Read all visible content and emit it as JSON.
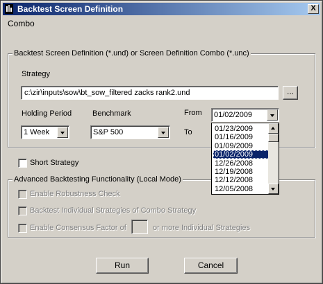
{
  "window": {
    "title": "Backtest Screen Definition",
    "close_label": "X"
  },
  "mode_label": "Combo",
  "definition_group": {
    "legend": "Backtest Screen Definition (*.und) or Screen Definition Combo (*.unc)",
    "strategy_label": "Strategy",
    "strategy_value": "c:\\zir\\inputs\\sow\\bt_sow_filtered zacks rank2.und",
    "browse_label": "...",
    "holding_period_label": "Holding Period",
    "holding_period_value": "1 Week",
    "benchmark_label": "Benchmark",
    "benchmark_value": "S&P 500",
    "from_label": "From",
    "from_value": "01/02/2009",
    "to_label": "To",
    "from_options": [
      "01/23/2009",
      "01/16/2009",
      "01/09/2009",
      "01/02/2009",
      "12/26/2008",
      "12/19/2008",
      "12/12/2008",
      "12/05/2008"
    ],
    "from_selected_index": 3
  },
  "short_strategy_label": "Short Strategy",
  "advanced_group": {
    "legend": "Advanced Backtesting Functionality (Local Mode)",
    "robustness_label": "Enable Robustness Check",
    "individual_label": "Backtest Individual Strategies of Combo Strategy",
    "consensus_label": "Enable Consensus Factor of",
    "consensus_suffix": "or more Individual Strategies"
  },
  "buttons": {
    "run": "Run",
    "cancel": "Cancel"
  },
  "colors": {
    "titlebar_start": "#0a246a",
    "titlebar_end": "#a6caf0",
    "dialog_bg": "#d4d0c8",
    "selection": "#0a246a"
  }
}
